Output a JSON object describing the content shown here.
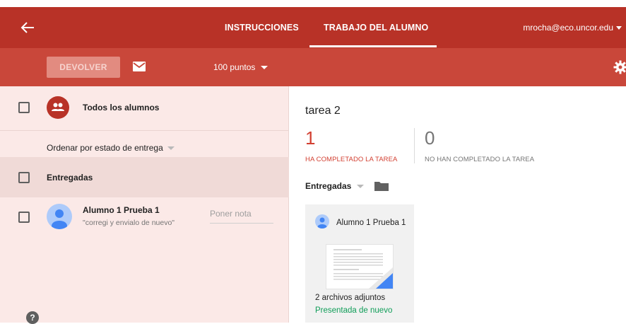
{
  "header": {
    "tabs": [
      {
        "label": "INSTRUCCIONES"
      },
      {
        "label": "TRABAJO DEL ALUMNO"
      }
    ],
    "account": "mrocha@eco.uncor.edu"
  },
  "toolbar": {
    "return_label": "DEVOLVER",
    "points_label": "100 puntos"
  },
  "left_panel": {
    "all_students_label": "Todos los alumnos",
    "sort_label": "Ordenar por estado de entrega",
    "group_label": "Entregadas",
    "students": [
      {
        "name": "Alumno 1 Prueba 1",
        "comment": "\"corregi y envialo de nuevo\"",
        "grade_placeholder": "Poner nota"
      }
    ],
    "help_glyph": "?"
  },
  "main": {
    "title": "tarea 2",
    "stats": [
      {
        "value": "1",
        "label": "HA COMPLETADO LA TAREA",
        "color": "#d23f31"
      },
      {
        "value": "0",
        "label": "NO HAN COMPLETADO LA TAREA",
        "color": "#757575"
      }
    ],
    "filter_label": "Entregadas",
    "cards": [
      {
        "name": "Alumno 1 Prueba 1",
        "attachments": "2 archivos adjuntos",
        "status": "Presentada de nuevo",
        "status_color": "#0f9d58"
      }
    ]
  },
  "colors": {
    "header_bg": "#b83227",
    "toolbar_bg": "#c9473a",
    "left_panel_bg": "#fbe9e7",
    "accent_red": "#d23f31"
  },
  "icons": [
    "back-arrow-icon",
    "mail-icon",
    "gear-icon",
    "group-icon",
    "person-icon",
    "folder-icon",
    "help-icon"
  ]
}
